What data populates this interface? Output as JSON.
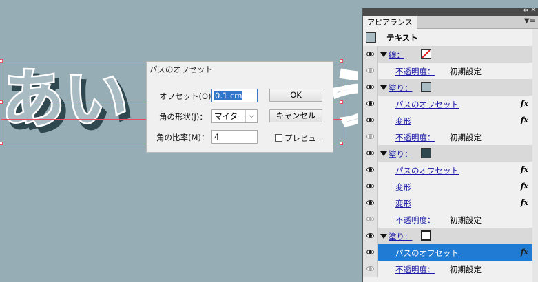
{
  "canvas": {
    "artwork_text": "あい",
    "artwork_partial_glyph": "う"
  },
  "dialog": {
    "title": "パスのオフセット",
    "offset_label": "オフセット(O)：",
    "offset_value": "0.1 cm",
    "joins_label": "角の形状(J)：",
    "joins_value": "マイター",
    "miter_label": "角の比率(M)：",
    "miter_value": "4",
    "ok_label": "OK",
    "cancel_label": "キャンセル",
    "preview_label": "プレビュー",
    "preview_checked": false
  },
  "panel": {
    "tab_label": "アピアランス",
    "object_label": "テキスト",
    "rows": [
      {
        "kind": "stroke",
        "label": "線：",
        "swatch": "none"
      },
      {
        "kind": "opacity",
        "label": "不透明度：",
        "value": "初期設定"
      },
      {
        "kind": "fill",
        "label": "塗り：",
        "swatch": "#a9bcc4"
      },
      {
        "kind": "effect",
        "label": "パスのオフセット",
        "fx": "fx"
      },
      {
        "kind": "effect",
        "label": "変形",
        "fx": "fx"
      },
      {
        "kind": "opacity",
        "label": "不透明度：",
        "value": "初期設定"
      },
      {
        "kind": "fill",
        "label": "塗り：",
        "swatch": "#2f474f"
      },
      {
        "kind": "effect",
        "label": "パスのオフセット",
        "fx": "fx"
      },
      {
        "kind": "effect",
        "label": "変形",
        "fx": "fx"
      },
      {
        "kind": "effect",
        "label": "変形",
        "fx": "fx"
      },
      {
        "kind": "opacity",
        "label": "不透明度：",
        "value": "初期設定"
      },
      {
        "kind": "fill",
        "label": "塗り：",
        "swatch": "#ffffff"
      },
      {
        "kind": "effect",
        "label": "パスのオフセット",
        "fx": "fx",
        "selected": true
      },
      {
        "kind": "opacity",
        "label": "不透明度：",
        "value": "初期設定"
      }
    ]
  },
  "colors": {
    "canvas_bg": "#97adb6",
    "selection": "#e84a5f",
    "highlight": "#1f7bd4"
  }
}
